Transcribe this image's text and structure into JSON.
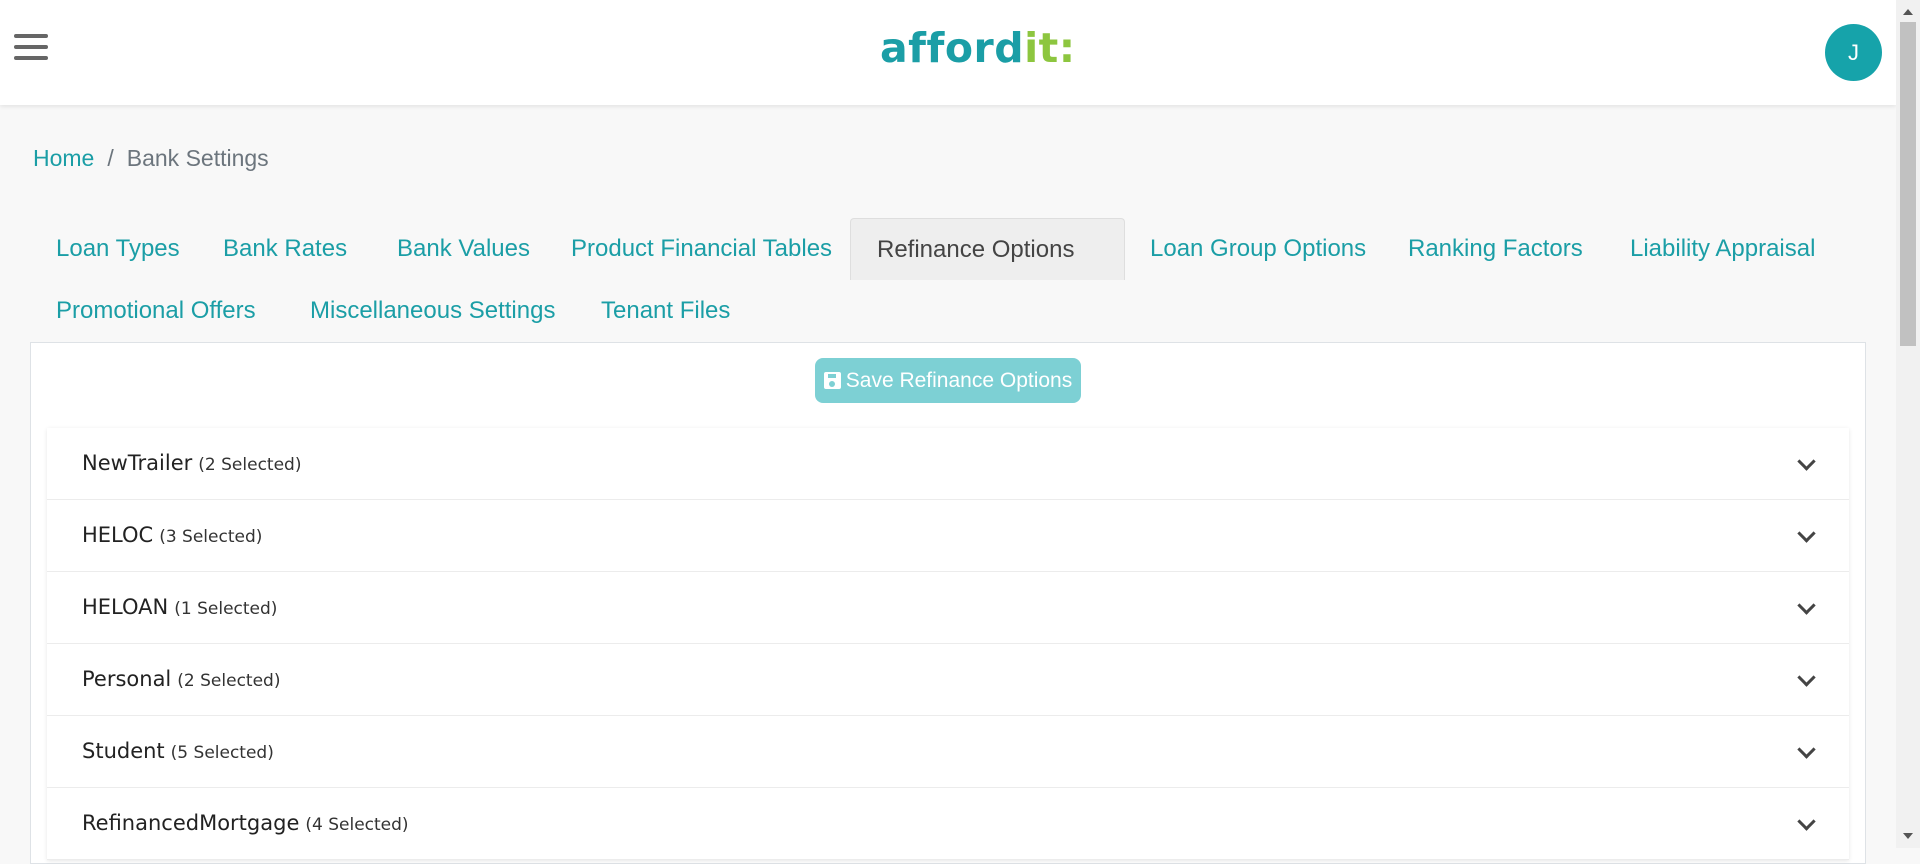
{
  "header": {
    "logo_part1": "afford",
    "logo_part2": "it:",
    "avatar_initial": "J"
  },
  "breadcrumb": {
    "home": "Home",
    "separator": "/",
    "current": "Bank Settings"
  },
  "tabs": [
    {
      "label": "Loan Types"
    },
    {
      "label": "Bank Rates"
    },
    {
      "label": "Bank Values"
    },
    {
      "label": "Product Financial Tables"
    },
    {
      "label": "Refinance Options",
      "active": true
    },
    {
      "label": "Loan Group Options"
    },
    {
      "label": "Ranking Factors"
    },
    {
      "label": "Liability Appraisal"
    },
    {
      "label": "Promotional Offers"
    },
    {
      "label": "Miscellaneous Settings"
    },
    {
      "label": "Tenant Files"
    }
  ],
  "save_button": {
    "label": "Save Refinance Options",
    "icon": "save-icon"
  },
  "accordion": [
    {
      "title": "NewTrailer",
      "count": "(2 Selected)"
    },
    {
      "title": "HELOC",
      "count": "(3 Selected)"
    },
    {
      "title": "HELOAN",
      "count": "(1 Selected)"
    },
    {
      "title": "Personal",
      "count": "(2 Selected)"
    },
    {
      "title": "Student",
      "count": "(5 Selected)"
    },
    {
      "title": "RefinancedMortgage",
      "count": "(4 Selected)"
    }
  ],
  "colors": {
    "brand": "#1b9ea6",
    "brand_accent": "#8dc63f",
    "button": "#7dd0d4"
  }
}
